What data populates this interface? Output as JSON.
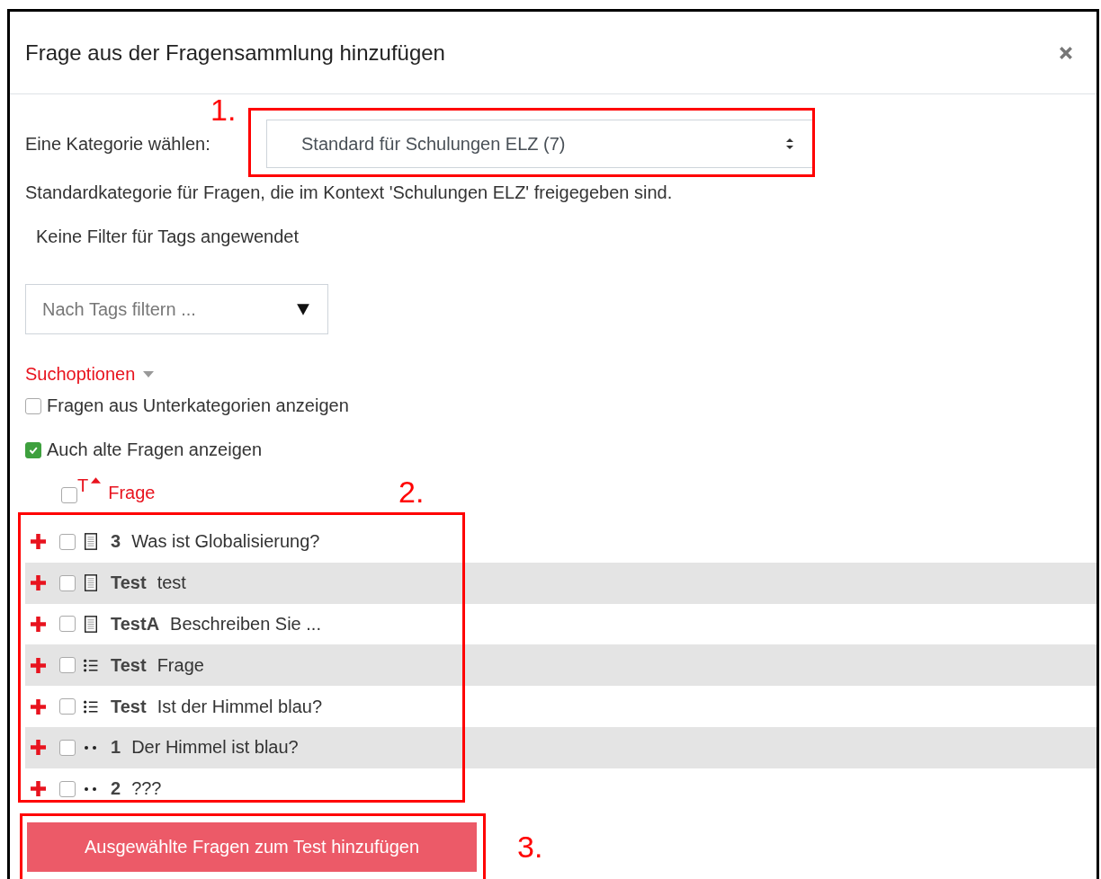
{
  "dialog": {
    "title": "Frage aus der Fragensammlung hinzufügen"
  },
  "category": {
    "label": "Eine Kategorie wählen:",
    "value": "Standard für Schulungen ELZ (7)"
  },
  "category_description": "Standardkategorie für Fragen, die im Kontext 'Schulungen ELZ' freigegeben sind.",
  "tag_filter_note": "Keine Filter für Tags angewendet",
  "tag_filter": {
    "placeholder": "Nach Tags filtern ..."
  },
  "search_options": {
    "label": "Suchoptionen",
    "expanded": true,
    "options": [
      {
        "label": "Fragen aus Unterkategorien anzeigen",
        "checked": false
      },
      {
        "label": "Auch alte Fragen anzeigen",
        "checked": true
      }
    ]
  },
  "table": {
    "select_all_checked": false,
    "columns": [
      {
        "label": "T",
        "sorted": true
      },
      {
        "label": "Frage"
      }
    ],
    "rows": [
      {
        "kind": "document",
        "name": "3",
        "text": "Was ist Globalisierung?",
        "checked": false
      },
      {
        "kind": "document",
        "name": "Test",
        "text": "test",
        "checked": false
      },
      {
        "kind": "document",
        "name": "TestA",
        "text": "Beschreiben Sie ...",
        "checked": false
      },
      {
        "kind": "list",
        "name": "Test",
        "text": "Frage",
        "checked": false
      },
      {
        "kind": "list",
        "name": "Test",
        "text": "Ist der Himmel blau?",
        "checked": false
      },
      {
        "kind": "dots",
        "name": "1",
        "text": "Der Himmel ist blau?",
        "checked": false
      },
      {
        "kind": "dots",
        "name": "2",
        "text": "???",
        "checked": false
      }
    ]
  },
  "submit_button": "Ausgewählte Fragen zum Test hinzufügen",
  "annotations": [
    "1.",
    "2.",
    "3."
  ]
}
